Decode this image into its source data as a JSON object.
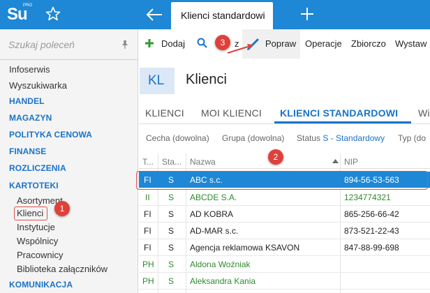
{
  "app": {
    "logo_text": "Su",
    "logo_sup": "PRO",
    "active_tab": "Klienci standardowi"
  },
  "sidebar": {
    "search_placeholder": "Szukaj poleceń",
    "items": [
      {
        "label": "Infoserwis",
        "type": "item"
      },
      {
        "label": "Wyszukiwarka",
        "type": "item"
      },
      {
        "label": "HANDEL",
        "type": "head"
      },
      {
        "label": "MAGAZYN",
        "type": "head"
      },
      {
        "label": "POLITYKA CENOWA",
        "type": "head"
      },
      {
        "label": "FINANSE",
        "type": "head"
      },
      {
        "label": "ROZLICZENIA",
        "type": "head"
      },
      {
        "label": "KARTOTEKI",
        "type": "head"
      }
    ],
    "sub_items": [
      "Asortyment",
      "Klienci",
      "Instytucje",
      "Wspólnicy",
      "Pracownicy",
      "Biblioteka załączników"
    ],
    "bottom_head": "KOMUNIKACJA"
  },
  "toolbar": {
    "add": "Dodaj",
    "search_partial": "z",
    "edit": "Popraw",
    "operations": "Operacje",
    "summary": "Zbiorczo",
    "print": "Wystaw"
  },
  "header": {
    "badge": "KL",
    "title": "Klienci"
  },
  "tabs": [
    "KLIENCI",
    "MOI KLIENCI",
    "KLIENCI STANDARDOWI",
    "Wi"
  ],
  "filters": {
    "cecha": "Cecha (dowolna)",
    "grupa": "Grupa (dowolna)",
    "status_label": "Status",
    "status_value": "S - Standardowy",
    "typ": "Typ (do"
  },
  "table": {
    "headers": [
      "T...",
      "Sta...",
      "Nazwa",
      "NIP"
    ],
    "rows": [
      {
        "t": "FI",
        "s": "S",
        "name": "ABC s.c.",
        "nip": "894-56-53-563",
        "selected": true,
        "green": false
      },
      {
        "t": "II",
        "s": "S",
        "name": "ABCDE S.A.",
        "nip": "1234774321",
        "selected": false,
        "green": true
      },
      {
        "t": "FI",
        "s": "S",
        "name": "AD KOBRA",
        "nip": "865-256-66-42",
        "selected": false,
        "green": false
      },
      {
        "t": "FI",
        "s": "S",
        "name": "AD-MAR s.c.",
        "nip": "873-521-22-43",
        "selected": false,
        "green": false
      },
      {
        "t": "FI",
        "s": "S",
        "name": "Agencja reklamowa KSAVON",
        "nip": "847-88-99-698",
        "selected": false,
        "green": false
      },
      {
        "t": "PH",
        "s": "S",
        "name": "Aldona Woźniak",
        "nip": "",
        "selected": false,
        "green": true
      },
      {
        "t": "PH",
        "s": "S",
        "name": "Aleksandra Kania",
        "nip": "",
        "selected": false,
        "green": true
      }
    ]
  },
  "callouts": [
    "1",
    "2",
    "3"
  ],
  "colors": {
    "accent": "#1e87d6",
    "link": "#1a73c8",
    "callout": "#e0403a",
    "green": "#2e8b2e"
  }
}
